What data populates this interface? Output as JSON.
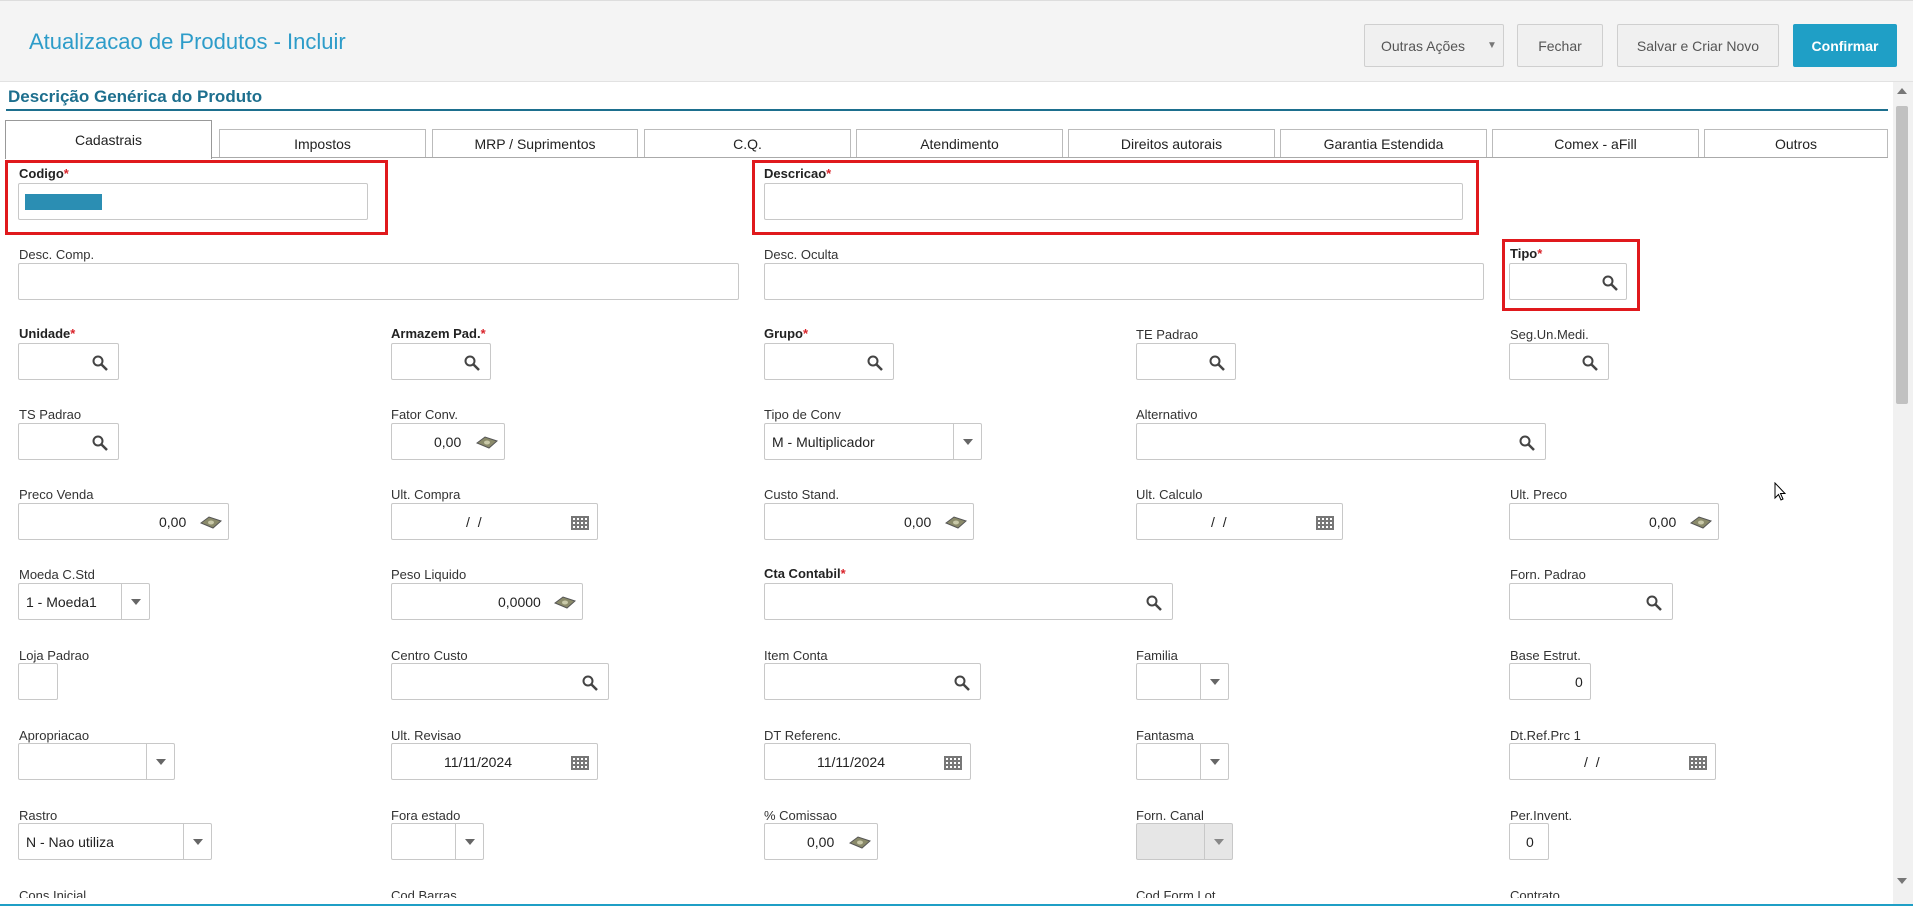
{
  "header": {
    "title": "Atualizacao de Produtos - Incluir",
    "buttons": {
      "outras_acoes": "Outras Ações",
      "fechar": "Fechar",
      "salvar_criar_novo": "Salvar e Criar Novo",
      "confirmar": "Confirmar"
    }
  },
  "section": {
    "title": "Descrição Genérica do Produto"
  },
  "tabs": [
    "Cadastrais",
    "Impostos",
    "MRP / Suprimentos",
    "C.Q.",
    "Atendimento",
    "Direitos autorais",
    "Garantia Estendida",
    "Comex - aFill",
    "Outros"
  ],
  "active_tab": "Cadastrais",
  "fields": {
    "codigo": {
      "label": "Codigo",
      "required": true,
      "value": ""
    },
    "descricao": {
      "label": "Descricao",
      "required": true,
      "value": ""
    },
    "desc_comp": {
      "label": "Desc. Comp.",
      "value": ""
    },
    "desc_oculta": {
      "label": "Desc. Oculta",
      "value": ""
    },
    "tipo": {
      "label": "Tipo",
      "required": true,
      "value": ""
    },
    "unidade": {
      "label": "Unidade",
      "required": true,
      "value": ""
    },
    "armazem_pad": {
      "label": "Armazem Pad.",
      "required": true,
      "value": ""
    },
    "grupo": {
      "label": "Grupo",
      "required": true,
      "value": ""
    },
    "te_padrao": {
      "label": "TE Padrao",
      "value": ""
    },
    "seg_un_medi": {
      "label": "Seg.Un.Medi.",
      "value": ""
    },
    "ts_padrao": {
      "label": "TS Padrao",
      "value": ""
    },
    "fator_conv": {
      "label": "Fator Conv.",
      "value": "0,00"
    },
    "tipo_de_conv": {
      "label": "Tipo de Conv",
      "value": "M - Multiplicador"
    },
    "alternativo": {
      "label": "Alternativo",
      "value": ""
    },
    "preco_venda": {
      "label": "Preco Venda",
      "value": "0,00"
    },
    "ult_compra": {
      "label": "Ult. Compra",
      "value": "/  /"
    },
    "custo_stand": {
      "label": "Custo Stand.",
      "value": "0,00"
    },
    "ult_calculo": {
      "label": "Ult. Calculo",
      "value": "/  /"
    },
    "ult_preco": {
      "label": "Ult. Preco",
      "value": "0,00"
    },
    "moeda_cstd": {
      "label": "Moeda C.Std",
      "value": "1 - Moeda1"
    },
    "peso_liquido": {
      "label": "Peso Liquido",
      "value": "0,0000"
    },
    "cta_contabil": {
      "label": "Cta Contabil",
      "required": true,
      "value": ""
    },
    "forn_padrao": {
      "label": "Forn. Padrao",
      "value": ""
    },
    "loja_padrao": {
      "label": "Loja Padrao",
      "value": ""
    },
    "centro_custo": {
      "label": "Centro Custo",
      "value": ""
    },
    "item_conta": {
      "label": "Item Conta",
      "value": ""
    },
    "familia": {
      "label": "Familia",
      "value": ""
    },
    "base_estrut": {
      "label": "Base Estrut.",
      "value": "0"
    },
    "apropriacao": {
      "label": "Apropriacao",
      "value": ""
    },
    "ult_revisao": {
      "label": "Ult. Revisao",
      "value": "11/11/2024"
    },
    "dt_referenc": {
      "label": "DT Referenc.",
      "value": "11/11/2024"
    },
    "fantasma": {
      "label": "Fantasma",
      "value": ""
    },
    "dt_ref_prc1": {
      "label": "Dt.Ref.Prc 1",
      "value": "/  /"
    },
    "rastro": {
      "label": "Rastro",
      "value": "N - Nao utiliza"
    },
    "fora_estado": {
      "label": "Fora estado",
      "value": ""
    },
    "comissao": {
      "label": "% Comissao",
      "value": "0,00"
    },
    "forn_canal": {
      "label": "Forn. Canal",
      "value": ""
    },
    "per_invent": {
      "label": "Per.Invent.",
      "value": "0"
    },
    "cons_inicial": {
      "label": "Cons.Inicial"
    },
    "cod_barras": {
      "label": "Cod Barras"
    },
    "cod_form_lot": {
      "label": "Cod Form Lot"
    },
    "contrato": {
      "label": "Contrato"
    }
  },
  "required_marker": "*",
  "colors": {
    "accent": "#1f9fc6",
    "title": "#2d9cc9",
    "highlight": "#e0191d"
  }
}
